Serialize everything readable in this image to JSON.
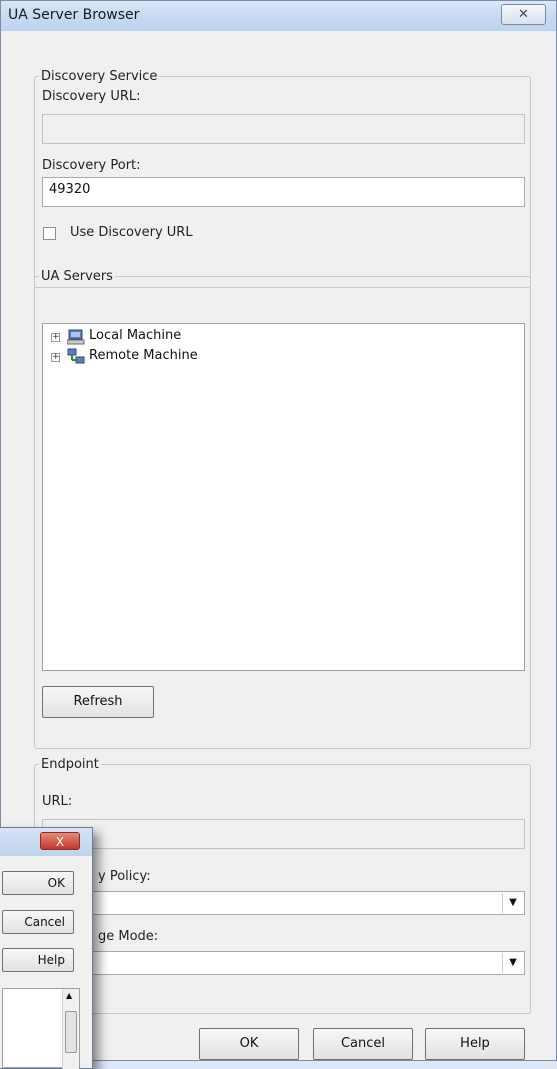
{
  "window": {
    "title": "UA Server Browser",
    "close_glyph": "✕"
  },
  "discovery": {
    "legend": "Discovery Service",
    "url_label": "Discovery URL:",
    "url_value": "",
    "port_label": "Discovery Port:",
    "port_value": "49320",
    "use_url_label": "Use Discovery URL",
    "use_url_checked": false
  },
  "servers": {
    "legend": "UA Servers",
    "tree": [
      {
        "label": "Local Machine",
        "icon": "computer-icon",
        "expander": "+"
      },
      {
        "label": "Remote Machine",
        "icon": "network-icon",
        "expander": "+"
      }
    ],
    "refresh_label": "Refresh"
  },
  "endpoint": {
    "legend": "Endpoint",
    "url_label": "URL:",
    "url_value": "",
    "policy_label_partial": "y Policy:",
    "mode_label_partial": "ge Mode:"
  },
  "buttons": {
    "ok": "OK",
    "cancel": "Cancel",
    "help": "Help"
  },
  "overlay": {
    "close_glyph": "X",
    "ok": "OK",
    "cancel": "Cancel",
    "help": "Help"
  }
}
